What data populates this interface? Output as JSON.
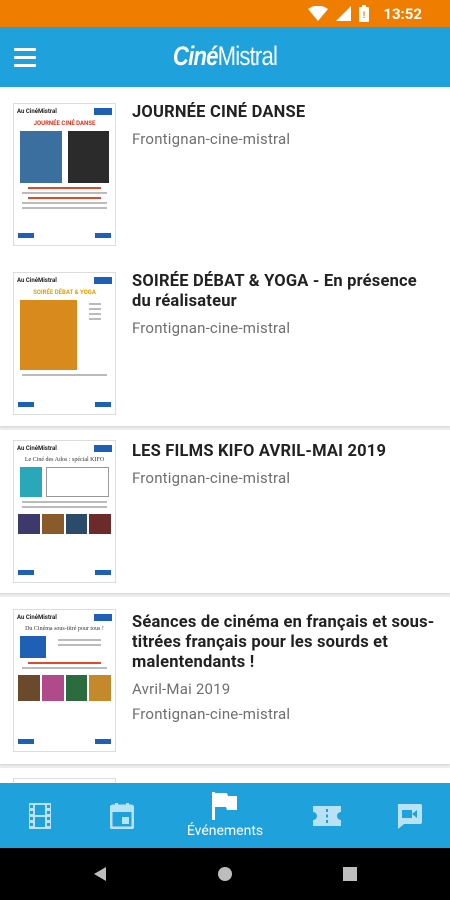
{
  "status_bar": {
    "time": "13:52"
  },
  "app": {
    "logo_part1": "Ciné",
    "logo_part2": "Mistral"
  },
  "events": [
    {
      "title": "JOURNÉE CINÉ DANSE",
      "date": "",
      "location": "Frontignan-cine-mistral",
      "thumb": {
        "brand": "Au CinéMistral",
        "headline": "JOURNÉE CINÉ DANSE"
      }
    },
    {
      "title": "SOIRÉE DÉBAT & YOGA - En présence du réalisateur",
      "date": "",
      "location": "Frontignan-cine-mistral",
      "thumb": {
        "brand": "Au CinéMistral",
        "headline": "SOIRÉE DÉBAT & YOGA"
      }
    },
    {
      "title": "LES FILMS KIFO AVRIL-MAI 2019",
      "date": "",
      "location": "Frontignan-cine-mistral",
      "thumb": {
        "brand": "Au CinéMistral",
        "headline": "Le Ciné des Ados : spécial KIFO"
      }
    },
    {
      "title": "Séances de cinéma en français et sous-titrées français pour les sourds et malentendants !",
      "date": "Avril-Mai 2019",
      "location": "Frontignan-cine-mistral",
      "thumb": {
        "brand": "Au CinéMistral",
        "headline": "Du Cinéma sous-titré pour tous !"
      }
    }
  ],
  "bottom_nav": {
    "items": [
      {
        "icon": "film-icon",
        "label": ""
      },
      {
        "icon": "calendar-icon",
        "label": ""
      },
      {
        "icon": "flag-icon",
        "label": "Événements",
        "active": true
      },
      {
        "icon": "ticket-icon",
        "label": ""
      },
      {
        "icon": "video-chat-icon",
        "label": ""
      }
    ]
  },
  "colors": {
    "status_bar": "#ef7d00",
    "primary": "#1fa1dc",
    "title_text": "#212121",
    "secondary_text": "#6f6f6f"
  }
}
